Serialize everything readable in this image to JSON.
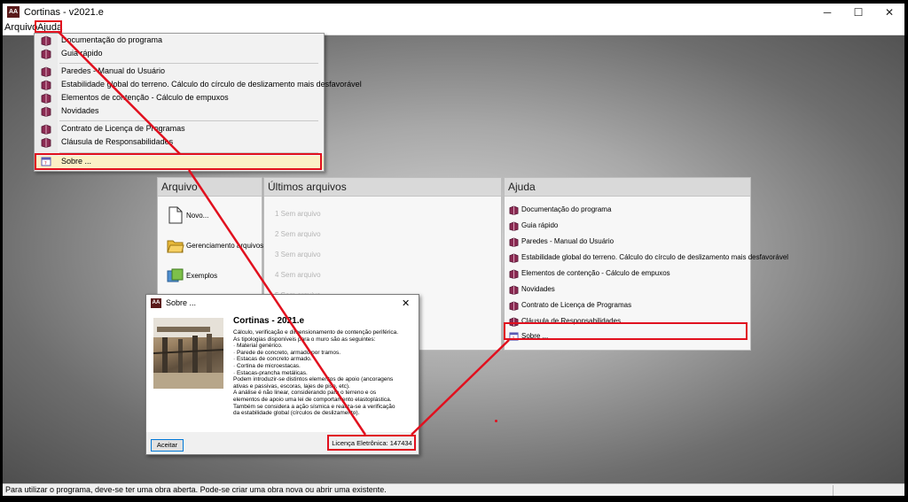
{
  "window": {
    "title": "Cortinas - v2021.e",
    "app_icon": "cortinas-app-icon",
    "app_icon_text": "AA",
    "minimize_glyph": "─",
    "maximize_glyph": "☐",
    "close_glyph": "✕"
  },
  "menubar": {
    "items": [
      "Arquivo",
      "Ajuda"
    ]
  },
  "help_menu": {
    "items": [
      "Documentação do programa",
      "Guia rápido",
      "Paredes - Manual do Usuário",
      "Estabilidade global do terreno. Cálculo do círculo de deslizamento mais desfavorável",
      "Elementos de contenção - Cálculo de empuxos",
      "Novidades",
      "Contrato de Licença de Programas",
      "Cláusula de Responsabilidades",
      "Sobre ..."
    ]
  },
  "panels": {
    "arquivo": {
      "title": "Arquivo",
      "items": [
        "Novo...",
        "Gerenciamento arquivos",
        "Exemplos"
      ]
    },
    "recent": {
      "title": "Últimos arquivos",
      "items": [
        "1 Sem arquivo",
        "2 Sem arquivo",
        "3 Sem arquivo",
        "4 Sem arquivo",
        "5 Sem arquivo"
      ]
    },
    "ajuda": {
      "title": "Ajuda",
      "items": [
        "Documentação do programa",
        "Guia rápido",
        "Paredes - Manual do Usuário",
        "Estabilidade global do terreno. Cálculo do círculo de deslizamento mais desfavorável",
        "Elementos de contenção - Cálculo de empuxos",
        "Novidades",
        "Contrato de Licença de Programas",
        "Cláusula de Responsabilidades",
        "Sobre ..."
      ]
    }
  },
  "dialog": {
    "title": "Sobre ...",
    "close_glyph": "✕",
    "heading": "Cortinas - 2021.e",
    "description_lines": [
      "Cálculo, verificação e dimensionamento de contenção periférica.",
      "As tipologias disponíveis para o muro são as seguintes:",
      "· Material genérico.",
      "· Parede de concreto, armado por tramos.",
      "· Estacas de concreto armado.",
      "· Cortina de microestacas.",
      "· Estacas-prancha metálicas.",
      "Podem introduzir-se distintos elementos de apoio (ancoragens",
      "ativas e passivas, escoras, lajes de piso, etc).",
      "A análise é não linear, considerando para o terreno e os",
      "elementos de apoio uma lei de comportamento elastoplástica.",
      "Também se considera a ação sísmica e realiza-se a verificação",
      "da estabilidade global (círculos de deslizamento)."
    ],
    "accept_label": "Aceitar",
    "license_label": "Licença Eletrônica: 147434"
  },
  "status": {
    "text": "Para utilizar o programa, deve-se ter uma obra aberta. Pode-se criar uma obra nova ou abrir uma existente."
  },
  "colors": {
    "annotation_red": "#e1101e",
    "book_icon": "#8b2a52",
    "highlight": "#fbf0c6"
  },
  "icons": {
    "menu_book": "book-icon",
    "about": "about-icon",
    "new": "new-document-icon",
    "manager": "folder-icon",
    "examples": "examples-icon"
  }
}
